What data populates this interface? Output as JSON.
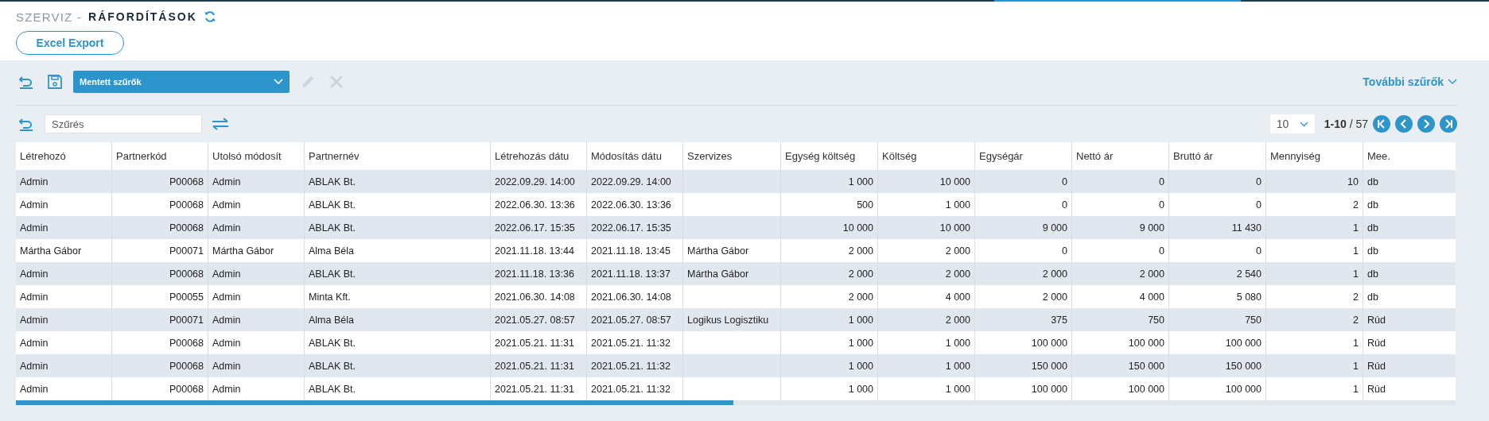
{
  "breadcrumb": {
    "section": "SZERVIZ -",
    "page": "RÁFORDÍTÁSOK"
  },
  "export_button": "Excel Export",
  "saved_filters": {
    "value": "Mentett szűrők"
  },
  "more_filters": "További szűrők",
  "filter": {
    "placeholder": "Szűrés"
  },
  "pagination": {
    "page_size": "10",
    "range": "1-10",
    "total": "/ 57"
  },
  "table": {
    "columns": [
      {
        "label": "Létrehozó"
      },
      {
        "label": "Partnerkód"
      },
      {
        "label": "Utolsó módosít"
      },
      {
        "label": "Partnernév"
      },
      {
        "label": "Létrehozás dátu"
      },
      {
        "label": "Módosítás dátu"
      },
      {
        "label": "Szervizes"
      },
      {
        "label": "Egység költség"
      },
      {
        "label": "Költség"
      },
      {
        "label": "Egységár"
      },
      {
        "label": "Nettó ár"
      },
      {
        "label": "Bruttó ár"
      },
      {
        "label": "Mennyiség"
      },
      {
        "label": "Mee."
      }
    ],
    "rows": [
      [
        "Admin",
        "P00068",
        "Admin",
        "ABLAK Bt.",
        "2022.09.29. 14:00",
        "2022.09.29. 14:00",
        "",
        "1 000",
        "10 000",
        "0",
        "0",
        "0",
        "10",
        "db"
      ],
      [
        "Admin",
        "P00068",
        "Admin",
        "ABLAK Bt.",
        "2022.06.30. 13:36",
        "2022.06.30. 13:36",
        "",
        "500",
        "1 000",
        "0",
        "0",
        "0",
        "2",
        "db"
      ],
      [
        "Admin",
        "P00068",
        "Admin",
        "ABLAK Bt.",
        "2022.06.17. 15:35",
        "2022.06.17. 15:35",
        "",
        "10 000",
        "10 000",
        "9 000",
        "9 000",
        "11 430",
        "1",
        "db"
      ],
      [
        "Mártha Gábor",
        "P00071",
        "Mártha Gábor",
        "Alma Béla",
        "2021.11.18. 13:44",
        "2021.11.18. 13:45",
        "Mártha Gábor",
        "2 000",
        "2 000",
        "0",
        "0",
        "0",
        "1",
        "db"
      ],
      [
        "Admin",
        "P00068",
        "Admin",
        "ABLAK Bt.",
        "2021.11.18. 13:36",
        "2021.11.18. 13:37",
        "Mártha Gábor",
        "2 000",
        "2 000",
        "2 000",
        "2 000",
        "2 540",
        "1",
        "db"
      ],
      [
        "Admin",
        "P00055",
        "Admin",
        "Minta Kft.",
        "2021.06.30. 14:08",
        "2021.06.30. 14:08",
        "",
        "2 000",
        "4 000",
        "2 000",
        "4 000",
        "5 080",
        "2",
        "db"
      ],
      [
        "Admin",
        "P00071",
        "Admin",
        "Alma Béla",
        "2021.05.27. 08:57",
        "2021.05.27. 08:57",
        "Logikus Logisztiku",
        "1 000",
        "2 000",
        "375",
        "750",
        "750",
        "2",
        "Rúd"
      ],
      [
        "Admin",
        "P00068",
        "Admin",
        "ABLAK Bt.",
        "2021.05.21. 11:31",
        "2021.05.21. 11:32",
        "",
        "1 000",
        "1 000",
        "100 000",
        "100 000",
        "100 000",
        "1",
        "Rúd"
      ],
      [
        "Admin",
        "P00068",
        "Admin",
        "ABLAK Bt.",
        "2021.05.21. 11:31",
        "2021.05.21. 11:32",
        "",
        "1 000",
        "1 000",
        "150 000",
        "150 000",
        "150 000",
        "1",
        "Rúd"
      ],
      [
        "Admin",
        "P00068",
        "Admin",
        "ABLAK Bt.",
        "2021.05.21. 11:31",
        "2021.05.21. 11:32",
        "",
        "1 000",
        "1 000",
        "100 000",
        "100 000",
        "100 000",
        "1",
        "Rúd"
      ]
    ]
  }
}
